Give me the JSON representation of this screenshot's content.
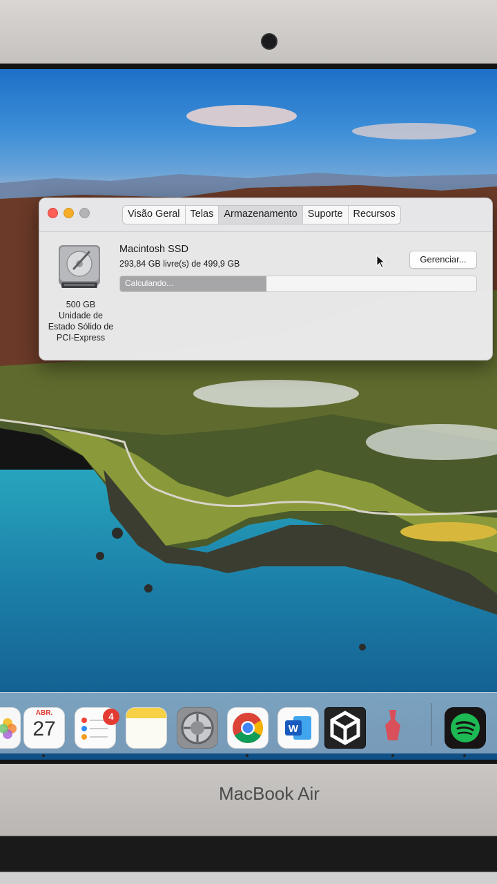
{
  "window": {
    "tabs": [
      {
        "label": "Visão Geral"
      },
      {
        "label": "Telas"
      },
      {
        "label": "Armazenamento",
        "active": true
      },
      {
        "label": "Suporte"
      },
      {
        "label": "Recursos"
      }
    ],
    "disk": {
      "capacity": "500 GB",
      "type_line1": "Unidade de",
      "type_line2": "Estado Sólido de",
      "type_line3": "PCI-Express",
      "name": "Macintosh SSD",
      "free_text": "293,84 GB livre(s) de 499,9 GB",
      "bar_label": "Calculando...",
      "used_fraction": 0.41,
      "icon": "hard-drive-icon"
    },
    "manage_button": "Gerenciar..."
  },
  "dock": {
    "calendar_month": "ABR.",
    "calendar_day": "27",
    "reminders_badge": "4",
    "items": [
      "photos-icon",
      "calendar-icon",
      "reminders-icon",
      "notes-icon",
      "system-preferences-icon",
      "chrome-icon",
      "word-icon",
      "unity-icon",
      "vector-app-icon",
      "spotify-icon"
    ]
  },
  "hardware": {
    "brand": "MacBook Air"
  },
  "colors": {
    "close": "#fd5f57",
    "minimize": "#f4ae2a",
    "badge": "#e33b32"
  }
}
